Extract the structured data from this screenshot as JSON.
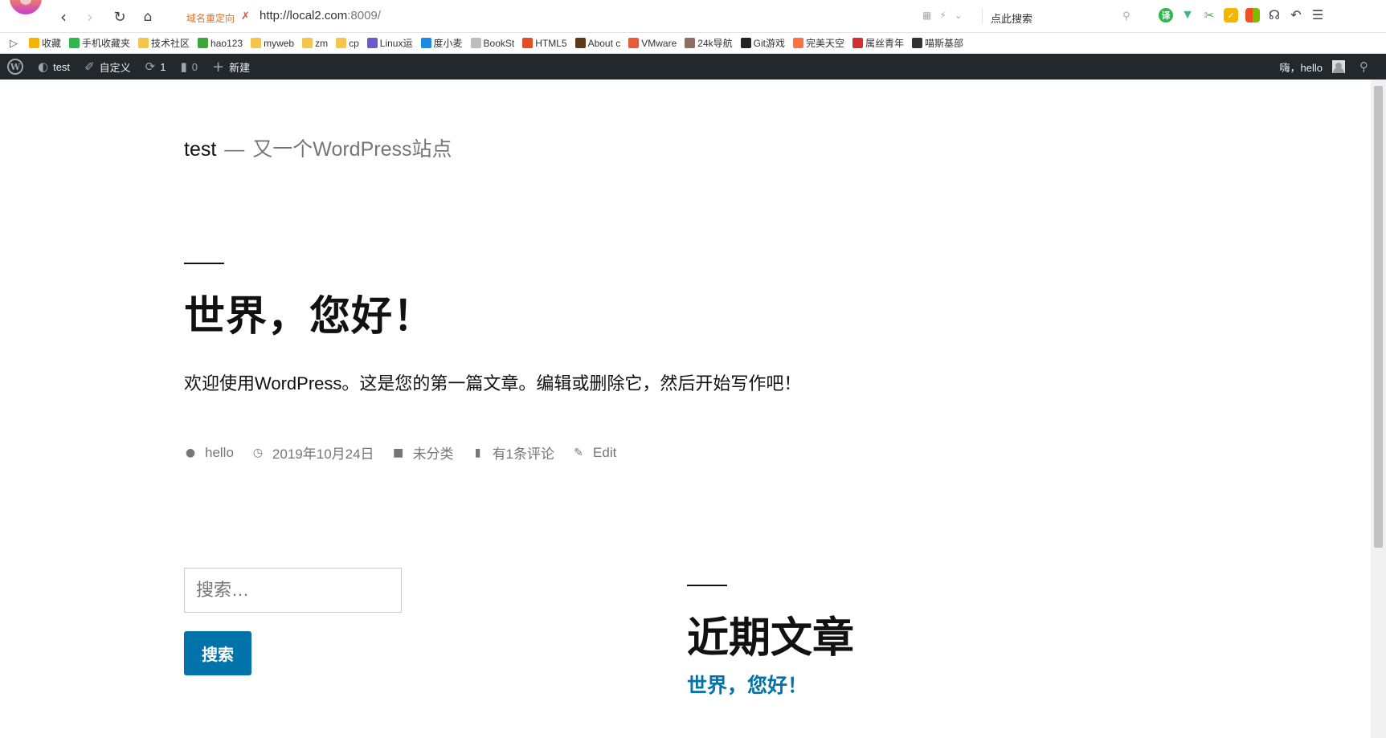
{
  "browser": {
    "redirect_label": "域名重定向",
    "url_host": "http://local2.com",
    "url_rest": ":8009/",
    "search_label": "点此搜索",
    "bookmarks": [
      {
        "label": "收藏",
        "color": "#f4b400"
      },
      {
        "label": "手机收藏夹",
        "color": "#2db84d"
      },
      {
        "label": "技术社区",
        "color": "#f5c54c"
      },
      {
        "label": "hao123",
        "color": "#3fa638"
      },
      {
        "label": "myweb",
        "color": "#f5c54c"
      },
      {
        "label": "zm",
        "color": "#f5c54c"
      },
      {
        "label": "cp",
        "color": "#f5c54c"
      },
      {
        "label": "Linux运",
        "color": "#6a5acd"
      },
      {
        "label": "度小麦",
        "color": "#1e88e5"
      },
      {
        "label": "BookSt",
        "color": "#bdbdbd"
      },
      {
        "label": "HTML5",
        "color": "#e44d26"
      },
      {
        "label": "About c",
        "color": "#5d3a1a"
      },
      {
        "label": "VMware",
        "color": "#e55b3c"
      },
      {
        "label": "24k导航",
        "color": "#8d6e63"
      },
      {
        "label": "Git游戏",
        "color": "#222222"
      },
      {
        "label": "完美天空",
        "color": "#ff7043"
      },
      {
        "label": "属丝青年",
        "color": "#d32f2f"
      },
      {
        "label": "喵斯基部",
        "color": "#333333"
      }
    ]
  },
  "adminbar": {
    "site_name": "test",
    "customize": "自定义",
    "updates_count": "1",
    "comments_count": "0",
    "new": "新建",
    "greeting": "嗨，hello"
  },
  "site": {
    "title": "test",
    "separator": "—",
    "description": "又一个WordPress站点"
  },
  "post": {
    "title": "世界，您好！",
    "body": "欢迎使用WordPress。这是您的第一篇文章。编辑或删除它，然后开始写作吧！",
    "meta": {
      "author": "hello",
      "date": "2019年10月24日",
      "category": "未分类",
      "comments": "有1条评论",
      "edit": "Edit"
    }
  },
  "sidebar": {
    "search_placeholder": "搜索…",
    "search_button": "搜索",
    "recent_posts_title": "近期文章",
    "recent_posts": [
      "世界，您好！"
    ]
  },
  "colors": {
    "link": "#0073aa",
    "adminbar_bg": "#23282d"
  }
}
